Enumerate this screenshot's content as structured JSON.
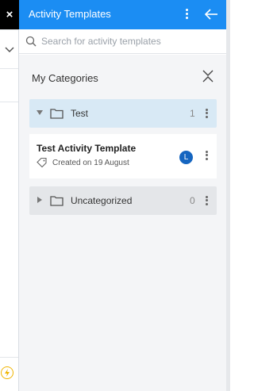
{
  "left": {
    "close_label": "×"
  },
  "header": {
    "title": "Activity Templates"
  },
  "search": {
    "placeholder": "Search for activity templates",
    "value": ""
  },
  "categories": {
    "title": "My Categories",
    "folders": [
      {
        "label": "Test",
        "count": "1"
      },
      {
        "label": "Uncategorized",
        "count": "0"
      }
    ]
  },
  "template": {
    "name": "Test Activity Template",
    "created": "Created on 19 August",
    "avatar_initial": "L"
  },
  "colors": {
    "header": "#1b8df3",
    "selected_row": "#d8e9f5",
    "avatar": "#1565c0"
  },
  "icons": [
    "close-icon",
    "chevron-down-icon",
    "lightning-icon",
    "kebab-icon",
    "arrow-left-icon",
    "search-icon",
    "collapse-icon",
    "folder-icon",
    "tag-icon"
  ]
}
